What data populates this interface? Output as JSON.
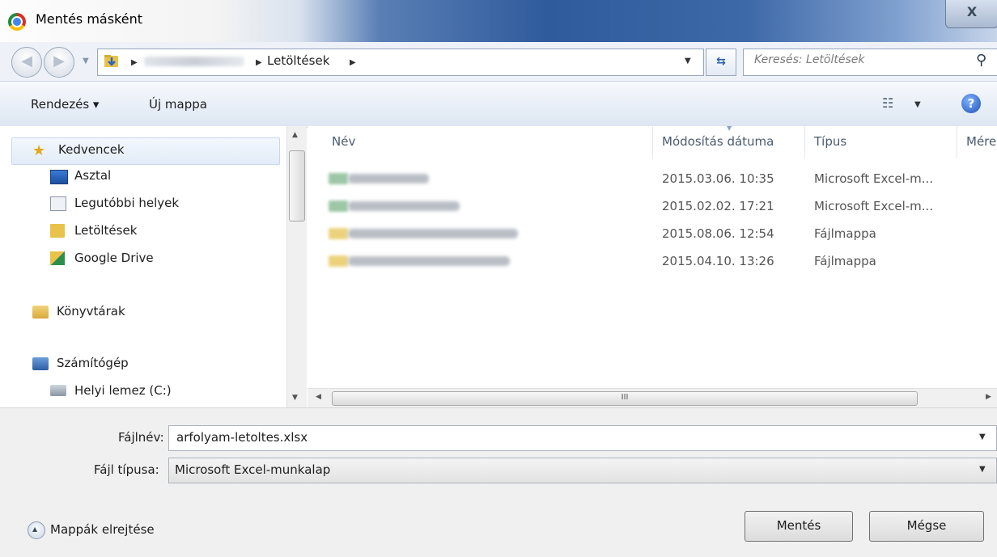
{
  "window": {
    "title": "Mentés másként",
    "close_label": "X"
  },
  "address": {
    "path_current": "Letöltések",
    "search_placeholder": "Keresés: Letöltések"
  },
  "toolbar": {
    "organize_label": "Rendezés ▾",
    "new_folder_label": "Új mappa"
  },
  "nav": {
    "items": [
      {
        "label": "Kedvencek"
      },
      {
        "label": "Asztal"
      },
      {
        "label": "Legutóbbi helyek"
      },
      {
        "label": "Letöltések"
      },
      {
        "label": "Google Drive"
      },
      {
        "label": "Könyvtárak"
      },
      {
        "label": "Számítógép"
      },
      {
        "label": "Helyi lemez (C:)"
      }
    ]
  },
  "files": {
    "columns": [
      "Név",
      "Módosítás dátuma",
      "Típus",
      "Mére"
    ],
    "rows": [
      {
        "date": "2015.03.06. 10:35",
        "type": "Microsoft Excel-m..."
      },
      {
        "date": "2015.02.02. 17:21",
        "type": "Microsoft Excel-m..."
      },
      {
        "date": "2015.08.06. 12:54",
        "type": "Fájlmappa"
      },
      {
        "date": "2015.04.10. 13:26",
        "type": "Fájlmappa"
      }
    ],
    "hscroll_grip": "III"
  },
  "form": {
    "filename_label": "Fájlnév:",
    "filename_value": "arfolyam-letoltes.xlsx",
    "filetype_label": "Fájl típusa:",
    "filetype_value": "Microsoft Excel-munkalap"
  },
  "footer": {
    "hide_folders_label": "Mappák elrejtése",
    "save_label": "Mentés",
    "cancel_label": "Mégse"
  },
  "colors": {
    "title_gradient": "#2f5a9c",
    "toolbar_bg": "#dde6f2",
    "panel_bg": "#f0f0f0"
  }
}
